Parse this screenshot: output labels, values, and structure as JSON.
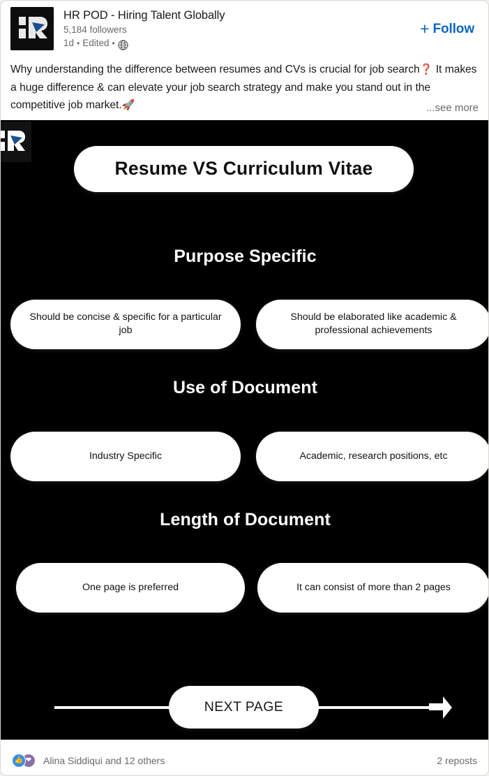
{
  "post": {
    "actor": {
      "name": "HR POD - Hiring Talent Globally",
      "followers": "5,184 followers",
      "time": "1d",
      "separator": "•",
      "edited": "Edited",
      "visibility_icon": "globe-icon",
      "avatar_alt": "HR POD logo"
    },
    "follow": {
      "plus": "+",
      "label": "Follow",
      "accent_color": "#0a66c2"
    },
    "commentary": {
      "line1": "Why understanding the difference between resumes and CVs is crucial for job",
      "line2_pre": "search",
      "emoji_question": "❓",
      "line2_post": "It makes a huge difference & can elevate your job search strategy and",
      "line3_pre": "make you stand out in the competitive job market.",
      "emoji_rocket": "🚀",
      "see_more": "...see more"
    },
    "footer": {
      "reaction_icons": [
        "like-icon",
        "love-icon"
      ],
      "reactions_text": "Alina Siddiqui and 12 others",
      "reposts_text": "2 reposts"
    }
  },
  "infographic": {
    "background_color": "#000000",
    "pill_color": "#ffffff",
    "watermark": "hr-pod-logo-watermark",
    "title": "Resume  VS  Curriculum Vitae",
    "sections": [
      {
        "heading": "Purpose Specific",
        "resume": "Should be concise & specific for a particular job",
        "cv": "Should be elaborated like academic & professional achievements"
      },
      {
        "heading": "Use of Document",
        "resume": "Industry Specific",
        "cv": "Academic, research positions, etc"
      },
      {
        "heading": "Length of Document",
        "resume": "One page is preferred",
        "cv": "It can consist of more than 2 pages"
      }
    ],
    "next_page_label": "NEXT PAGE"
  }
}
